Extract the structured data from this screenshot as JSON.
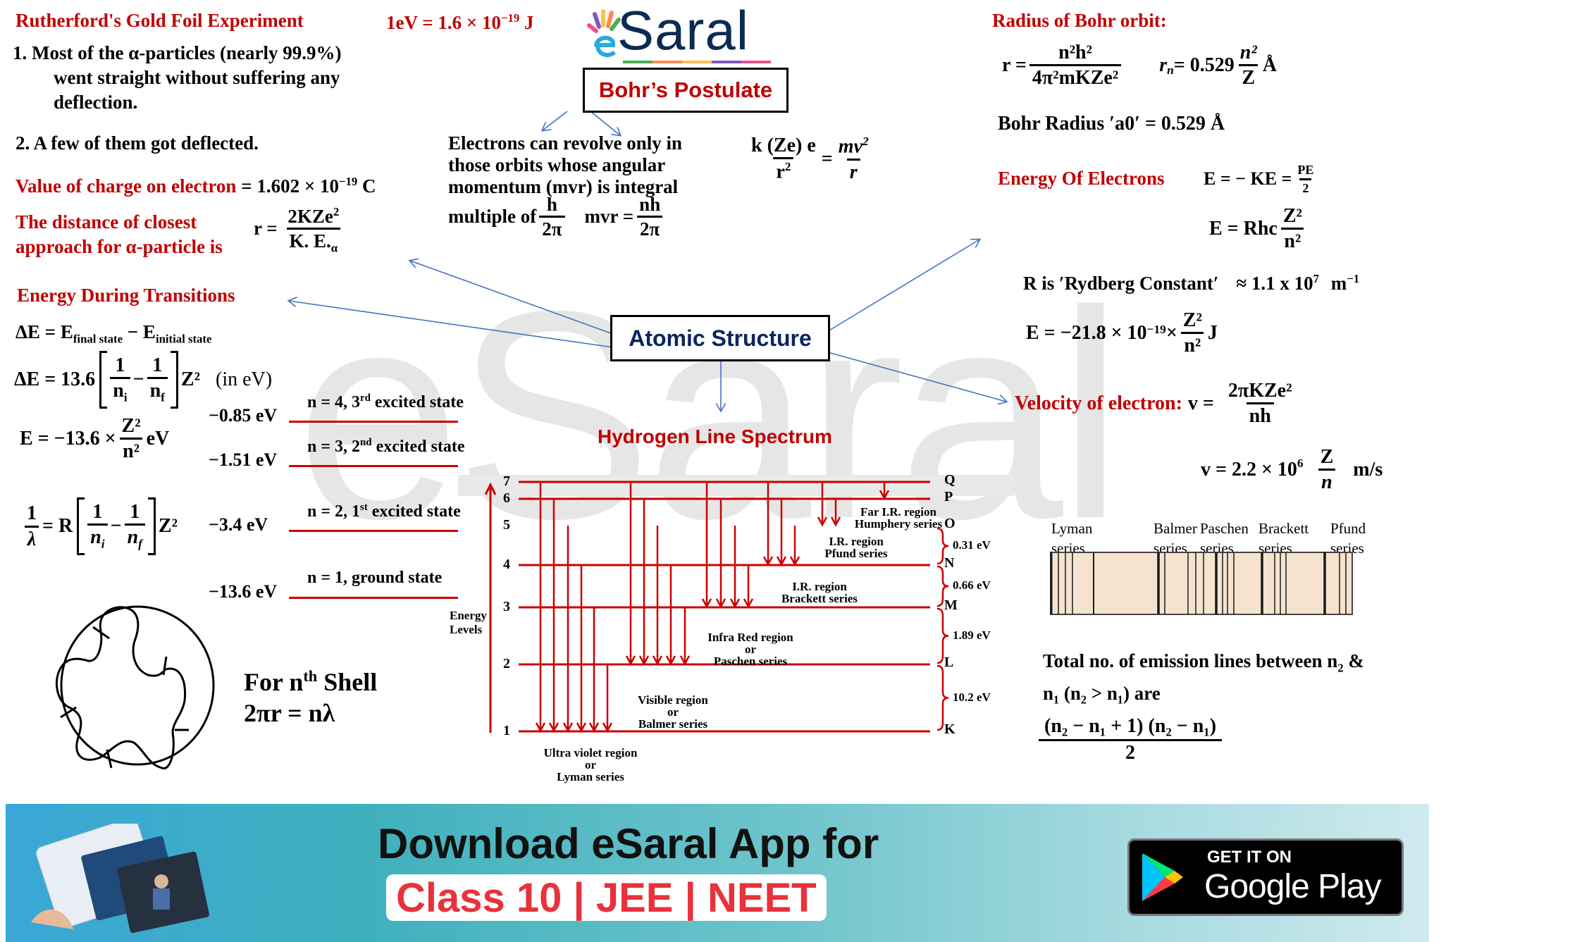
{
  "logo": {
    "text": "Saral",
    "prefix": "e",
    "underline_colors": [
      "#4caf50",
      "#ff8a50",
      "#ffc04d",
      "#7e57c2",
      "#ec4f8f"
    ],
    "brand_color": "#0b2b52"
  },
  "colors": {
    "accent_red": "#c00000",
    "diagram_red": "#cc0000",
    "arrow_blue": "#4472c4",
    "navy": "#002060"
  },
  "rutherford": {
    "title": "Rutherford's Gold Foil Experiment",
    "ev_conversion": {
      "lhs": "1eV = 1.6 × 10",
      "exp": "−19",
      "unit": " J"
    },
    "point1_line1": "1. Most of the α-particles (nearly 99.9%)",
    "point1_line2": "went straight without suffering any",
    "point1_line3": "deflection.",
    "point2": "2. A few of them got deflected.",
    "charge_label": "Value of charge on electron",
    "charge_value": " = 1.602 × 10",
    "charge_exp": "−19",
    "charge_unit": " C",
    "closest_label_line1": "The distance of closest",
    "closest_label_line2": "approach for α-particle is",
    "closest_lhs": "r =",
    "closest_num": "2KZe",
    "closest_num_sup": "2",
    "closest_den": "K. E.",
    "closest_den_sub": "α"
  },
  "bohr_postulate": {
    "title": "Bohr’s Postulate",
    "statement_line1": "Electrons can revolve only in",
    "statement_line2": "those orbits whose angular",
    "statement_line3": "momentum (mvr) is integral",
    "statement_line4": "multiple of",
    "h_num": "h",
    "two_pi": "2π",
    "mvr_lhs": "mvr =",
    "nh_num": "nh",
    "force_num": "k (Ze) e",
    "force_den": "r",
    "force_den_sup": "2",
    "force_rhs_num": "mv",
    "force_rhs_sup": "2",
    "force_rhs_den": "r",
    "equals": "="
  },
  "bohr_radius": {
    "title": "Radius of Bohr orbit:",
    "r_lhs": "r =",
    "r_num": "n²h²",
    "r_den": "4π²mKZe²",
    "rn_lhs": "r",
    "rn_sub": "n",
    "rn_mid": " = 0.529",
    "rn_num": "n²",
    "rn_den": "Z",
    "rn_unit": "Å",
    "a0_text": "Bohr Radius ′a0′ = 0.529  Å"
  },
  "energy_electrons": {
    "title": "Energy Of Electrons",
    "eq1_lhs": "E = − KE =",
    "eq1_num": "PE",
    "eq1_den": "2",
    "eq2_lhs": "E = Rhc",
    "eq2_num": "Z²",
    "eq2_den": "n²",
    "rydberg_text": "R is ′Rydberg Constant′",
    "rydberg_value": "≈ 1.1 x 10",
    "rydberg_exp": "7",
    "rydberg_unit": "m",
    "rydberg_unit_exp": "−1",
    "eq3_lhs": "E = −21.8 × 10",
    "eq3_exp": "−19",
    "eq3_times": " ×",
    "eq3_num": "Z²",
    "eq3_den": "n²",
    "eq3_unit": "J"
  },
  "velocity": {
    "title": "Velocity of electron:",
    "lhs": "v  =",
    "num": "2πKZe²",
    "den": "nh",
    "eq2_lhs": "v = 2.2 × 10",
    "eq2_exp": "6",
    "eq2_num": "Z",
    "eq2_den": "n",
    "eq2_unit": "m/s"
  },
  "transitions": {
    "title": "Energy During Transitions",
    "delta_lhs": "ΔE = E",
    "delta_sub1": "final state",
    "delta_mid": " − E",
    "delta_sub2": "initial state",
    "de_lhs": "ΔE = 13.6",
    "de_term1_num": "1",
    "de_term1_den": "n",
    "de_term1_sub": "i",
    "de_term2_num": "1",
    "de_term2_den": "n",
    "de_term2_sub": "f",
    "de_z": "Z²",
    "de_unit": "(in eV)",
    "e_lhs": "E = −13.6 ×",
    "e_num": "Z²",
    "e_den": "n²",
    "e_unit": "eV",
    "lambda_num": "1",
    "lambda_den": "λ",
    "lambda_eq": "= R",
    "minus": "−",
    "z2": "Z²"
  },
  "left_levels": [
    {
      "energy": "−0.85 eV",
      "label": "n = 4, 3",
      "sup": "rd",
      "rest": " excited state"
    },
    {
      "energy": "−1.51 eV",
      "label": "n = 3, 2",
      "sup": "nd",
      "rest": " excited state"
    },
    {
      "energy": "−3.4 eV",
      "label": "n = 2, 1",
      "sup": "st",
      "rest": " excited state"
    },
    {
      "energy": "−13.6 eV",
      "label": "n = 1, ground state",
      "sup": "",
      "rest": ""
    }
  ],
  "shell": {
    "line1_a": "For n",
    "line1_sup": "th",
    "line1_b": " Shell",
    "line2": "2πr = nλ"
  },
  "atomic_structure": {
    "title": "Atomic Structure"
  },
  "hydrogen_spectrum": {
    "title": "Hydrogen Line Spectrum",
    "axis_label_line1": "Energy",
    "axis_label_line2": "Levels",
    "levels": [
      {
        "n": "7",
        "shell": "Q"
      },
      {
        "n": "6",
        "shell": "P"
      },
      {
        "n": "5",
        "shell": "O"
      },
      {
        "n": "4",
        "shell": "N"
      },
      {
        "n": "3",
        "shell": "M"
      },
      {
        "n": "2",
        "shell": "L"
      },
      {
        "n": "1",
        "shell": "K"
      }
    ],
    "gaps": [
      "0.31 eV",
      "0.66 eV",
      "1.89 eV",
      "10.2 eV"
    ],
    "series": [
      {
        "name": "Lyman",
        "line1": "Ultra violet region",
        "line2": "or",
        "line3": "Lyman series",
        "to": 1,
        "from": [
          7,
          6,
          5,
          4,
          3,
          2
        ]
      },
      {
        "name": "Balmer",
        "line1": "Visible region",
        "line2": "or",
        "line3": "Balmer series",
        "to": 2,
        "from": [
          7,
          6,
          5,
          4,
          3
        ]
      },
      {
        "name": "Paschen",
        "line1": "Infra Red region",
        "line2": "or",
        "line3": "Paschen series",
        "to": 3,
        "from": [
          7,
          6,
          5,
          4
        ]
      },
      {
        "name": "Brackett",
        "line1": "I.R. region",
        "line2": "Brackett series",
        "line3": "",
        "to": 4,
        "from": [
          7,
          6,
          5
        ]
      },
      {
        "name": "Pfund",
        "line1": "I.R. region",
        "line2": "Pfund series",
        "line3": "",
        "to": 5,
        "from": [
          7,
          6
        ]
      },
      {
        "name": "Humphery",
        "line1": "Far I.R. region",
        "line2": "Humphery series",
        "line3": "",
        "to": 6,
        "from": [
          7
        ]
      }
    ]
  },
  "spectrum_bar": {
    "labels": [
      {
        "name": "Lyman",
        "sub": "series"
      },
      {
        "name": "Balmer",
        "sub": "series"
      },
      {
        "name": "Paschen",
        "sub": "series"
      },
      {
        "name": "Brackett",
        "sub": "series"
      },
      {
        "name": "Pfund",
        "sub": "series"
      }
    ],
    "fill_color": "#f5e3d0"
  },
  "emission_lines": {
    "text_line1_a": "Total no. of emission lines between n",
    "text_line1_sub": "2",
    "text_line1_b": " &",
    "text_line2": "n₁ (n₂ > n₁) are",
    "formula_num": "(n₂ − n₁ + 1) (n₂ − n₁)",
    "formula_den": "2"
  },
  "banner": {
    "headline": "Download eSaral App for",
    "sub": "Class 10 | JEE | NEET",
    "badge_top": "GET IT ON",
    "badge_bottom": "Google Play"
  }
}
